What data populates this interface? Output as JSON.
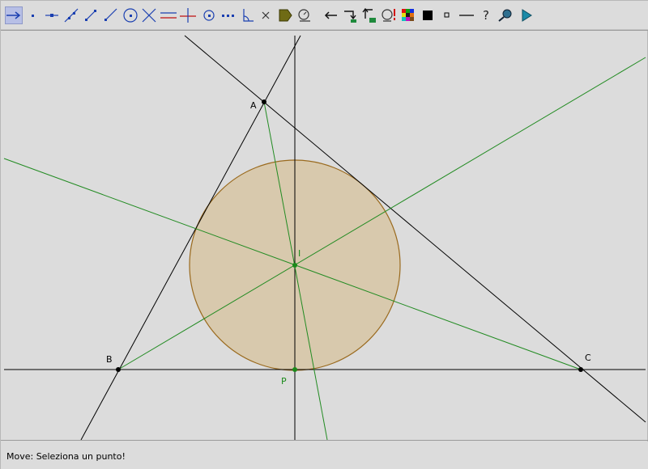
{
  "toolbar": {
    "tools": [
      {
        "name": "move-tool",
        "icon": "move-arrow-icon",
        "active": true
      },
      {
        "name": "point-tool",
        "icon": "point-icon"
      },
      {
        "name": "point-on-object-tool",
        "icon": "point-on-line-icon"
      },
      {
        "name": "line-tool",
        "icon": "line-icon"
      },
      {
        "name": "segment-tool",
        "icon": "segment-icon"
      },
      {
        "name": "ray-tool",
        "icon": "ray-icon"
      },
      {
        "name": "circle-tool",
        "icon": "circle-icon"
      },
      {
        "name": "intersection-tool",
        "icon": "intersection-icon"
      },
      {
        "name": "parallel-tool",
        "icon": "parallel-icon"
      },
      {
        "name": "perpendicular-tool",
        "icon": "perpendicular-icon"
      },
      {
        "name": "compass-tool",
        "icon": "compass-icon"
      },
      {
        "name": "locus-tool",
        "icon": "locus-icon"
      },
      {
        "name": "angle-tool",
        "icon": "angle-icon"
      },
      {
        "name": "delete-tool",
        "icon": "delete-x-icon"
      },
      {
        "name": "label-tool",
        "icon": "tag-icon"
      },
      {
        "name": "measure-tool",
        "icon": "measure-icon"
      },
      {
        "name": "undo-tool",
        "icon": "undo-arrow-icon"
      },
      {
        "name": "macro-start-tool",
        "icon": "macro-start-icon"
      },
      {
        "name": "macro-end-tool",
        "icon": "macro-end-icon"
      },
      {
        "name": "calculator-tool",
        "icon": "calculator-icon"
      },
      {
        "name": "color-tool",
        "icon": "color-palette-icon"
      },
      {
        "name": "fill-tool",
        "icon": "filled-square-icon"
      },
      {
        "name": "point-style-tool",
        "icon": "small-square-icon"
      },
      {
        "name": "line-style-tool",
        "icon": "line-style-icon"
      },
      {
        "name": "help-tool",
        "icon": "question-icon"
      },
      {
        "name": "zoom-tool",
        "icon": "magnifier-icon"
      },
      {
        "name": "run-tool",
        "icon": "play-icon"
      }
    ],
    "help_glyph": "?"
  },
  "construction": {
    "points": {
      "A": {
        "label": "A"
      },
      "B": {
        "label": "B"
      },
      "C": {
        "label": "C"
      },
      "I": {
        "label": "I"
      },
      "P": {
        "label": "P"
      }
    },
    "colors": {
      "triangle_lines": "#000000",
      "bisectors": "#228b22",
      "incircle_fill": "#d8c9ad",
      "incircle_stroke": "#9a6a1e",
      "background": "#dcdcdc"
    }
  },
  "status": {
    "message": "Move: Seleziona un punto!"
  }
}
